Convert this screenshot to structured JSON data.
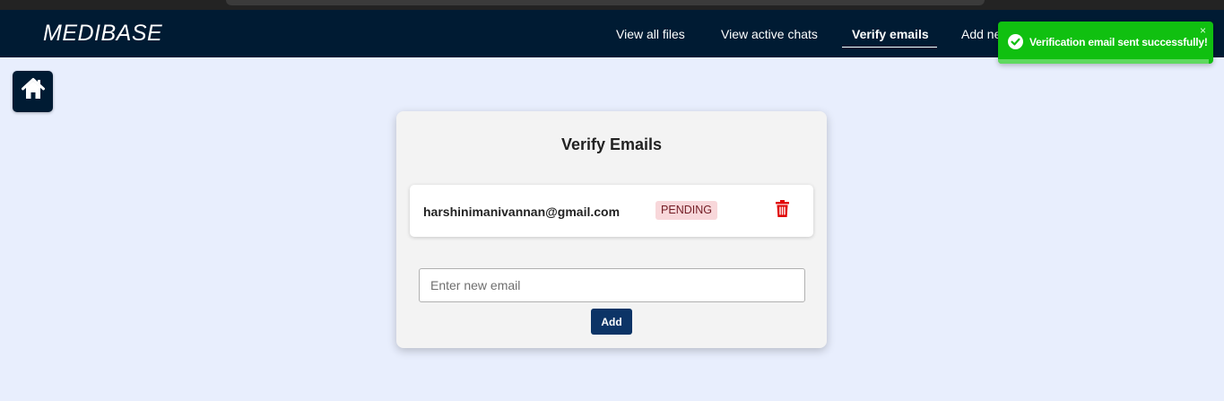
{
  "brand": "MEDIBASE",
  "nav": {
    "view_all_files": "View all files",
    "view_active_chats": "View active chats",
    "verify_emails": "Verify emails",
    "add_new": "Add ne"
  },
  "toast": {
    "message": "Verification email sent successfully!",
    "close": "×",
    "type": "success",
    "progress_fraction": 0.98,
    "color": "#10c010"
  },
  "card": {
    "title": "Verify Emails",
    "emails": [
      {
        "address": "harshinimanivannan@gmail.com",
        "status": "PENDING"
      }
    ]
  },
  "form": {
    "placeholder": "Enter new email",
    "value": "",
    "add_label": "Add"
  },
  "icons": {
    "home": "home-icon",
    "delete": "trash-icon",
    "success": "check-circle-icon"
  },
  "colors": {
    "navbar": "#001b33",
    "background": "#e8eefd",
    "pending_badge_bg": "#f8d7da",
    "delete_red": "#e00000",
    "add_button": "#0c3466"
  }
}
